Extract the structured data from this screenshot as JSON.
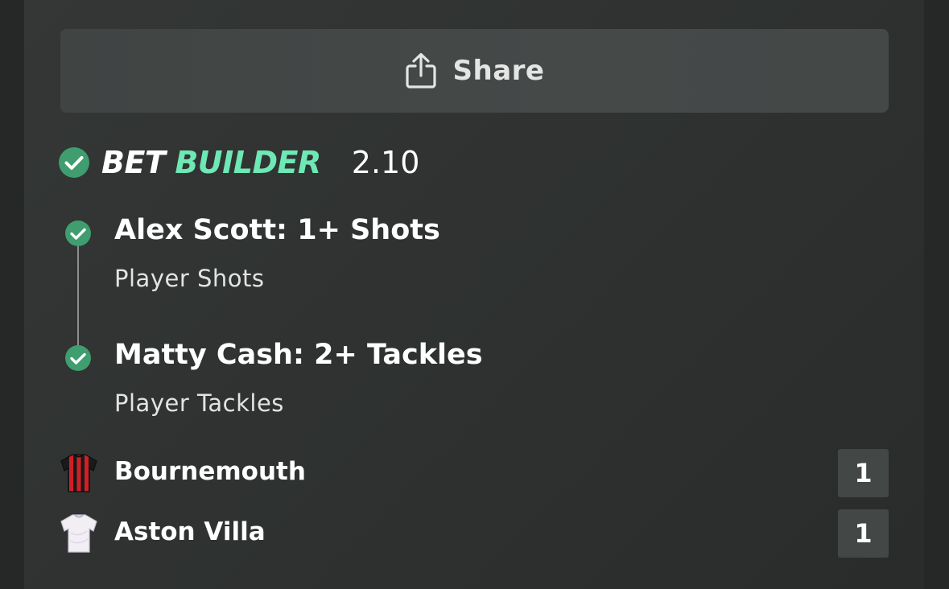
{
  "share": {
    "label": "Share",
    "icon": "share-icon"
  },
  "bet_builder": {
    "word1": "BET",
    "word2": "BUILDER",
    "odds": "2.10",
    "icon": "check-circle-icon",
    "accent_color": "#6ee8b5",
    "check_color": "#3f9d6f"
  },
  "legs": [
    {
      "title": "Alex Scott: 1+ Shots",
      "market": "Player Shots",
      "status_icon": "check-circle-icon"
    },
    {
      "title": "Matty Cash: 2+ Tackles",
      "market": "Player Tackles",
      "status_icon": "check-circle-icon"
    }
  ],
  "teams": [
    {
      "name": "Bournemouth",
      "score": "1",
      "kit_icon": "bournemouth-kit-icon"
    },
    {
      "name": "Aston Villa",
      "score": "1",
      "kit_icon": "aston-villa-kit-icon"
    }
  ]
}
